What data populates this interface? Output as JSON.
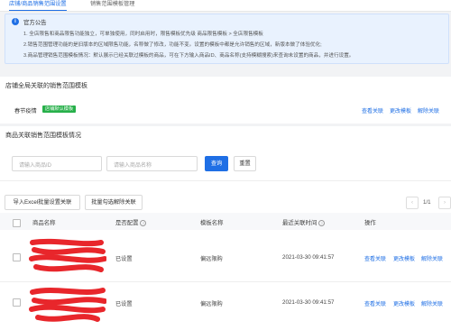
{
  "tabs": [
    "店铺/商品销售范围设置",
    "销售范围模板管理"
  ],
  "notice": {
    "title": "官方公告",
    "lines": [
      "1. 全店限售和商品限售功能独立，可单独使用，同时启用时，限售模板优先级 商品限售模板 > 全店限售模板",
      "2.销售范围管理功能的是旧版本的区域限售功能，名称做了修改，功能不变。设置的模板中都是允许销售的区域，新版本做了体验优化;",
      "3.商品管理销售范围模板情况：默认展示已经关联过模板的商品，可在下方输入商品ID、商品名称(支持模糊搜索)来查询未设置的商品，并进行设置。"
    ]
  },
  "store_section": {
    "title": "店铺全局关联的销售范围模板",
    "template_name": "春节疫情",
    "badge": "店铺默认模板",
    "actions": [
      "查看关联",
      "更改模板",
      "解除关联"
    ]
  },
  "goods_section": {
    "title": "商品关联销售范围模板情况",
    "id_placeholder": "请输入商品ID",
    "name_placeholder": "请输入商品名称",
    "search_label": "查询",
    "reset_label": "重置"
  },
  "toolbar": {
    "import_label": "导入Excel批量设置关联",
    "batch_unlink_label": "批量勾选解除关联",
    "page_text": "1/1",
    "prev": "‹",
    "next": "›"
  },
  "table": {
    "headers": [
      "商品名称",
      "是否配置",
      "模板名称",
      "最近关联时间",
      "操作"
    ],
    "help_glyph": "?",
    "rows": [
      {
        "configured": "已设置",
        "template": "偏远限购",
        "time": "2021-03-30 09:41:57",
        "actions": [
          "查看关联",
          "更改模板",
          "解除关联"
        ]
      },
      {
        "configured": "已设置",
        "template": "偏远限购",
        "time": "2021-03-30 09:41:57",
        "actions": [
          "查看关联",
          "更改模板",
          "解除关联"
        ]
      }
    ]
  },
  "colors": {
    "accent": "#1f6fe5",
    "badge": "#27b04a",
    "redaction": "#e8262b"
  }
}
